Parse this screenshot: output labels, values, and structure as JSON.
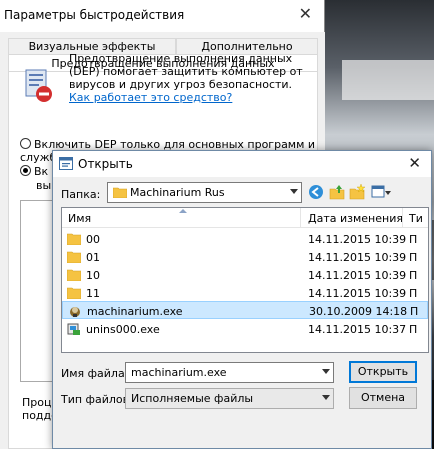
{
  "perf_window": {
    "title": "Параметры быстродействия",
    "close_glyph": "✕",
    "tabs": [
      "Визуальные эффекты",
      "Дополнительно"
    ],
    "active_tab": "Предотвращение выполнения данных",
    "description": "Предотвращение выполнения данных (DEP) помогает защитить компьютер от вирусов и других угроз безопасности.",
    "link": "Как работает это средство?",
    "radio1_label": "Включить DEP только для основных программ и служб Wi",
    "radio2_label": "Вк",
    "radio2_line2": "вы",
    "bottom_line1": "Проц",
    "bottom_line2": "подде"
  },
  "open_dialog": {
    "title": "Открыть",
    "close_glyph": "✕",
    "folder_label": "Папка:",
    "folder_value": "Machinarium Rus",
    "columns": {
      "name": "Имя",
      "date": "Дата изменения",
      "type": "Ти"
    },
    "files": [
      {
        "name": "00",
        "date": "14.11.2015 10:39",
        "type": "П",
        "kind": "folder"
      },
      {
        "name": "01",
        "date": "14.11.2015 10:39",
        "type": "П",
        "kind": "folder"
      },
      {
        "name": "10",
        "date": "14.11.2015 10:39",
        "type": "П",
        "kind": "folder"
      },
      {
        "name": "11",
        "date": "14.11.2015 10:39",
        "type": "П",
        "kind": "folder"
      },
      {
        "name": "machinarium.exe",
        "date": "30.10.2009 14:18",
        "type": "П",
        "kind": "exe-game",
        "selected": true
      },
      {
        "name": "unins000.exe",
        "date": "14.11.2015 10:37",
        "type": "П",
        "kind": "exe-installer"
      }
    ],
    "filename_label": "Имя файла:",
    "filename_value": "machinarium.exe",
    "filetype_label": "Тип файлов:",
    "filetype_value": "Исполняемые файлы",
    "open_button": "Открыть",
    "cancel_button": "Отмена"
  }
}
